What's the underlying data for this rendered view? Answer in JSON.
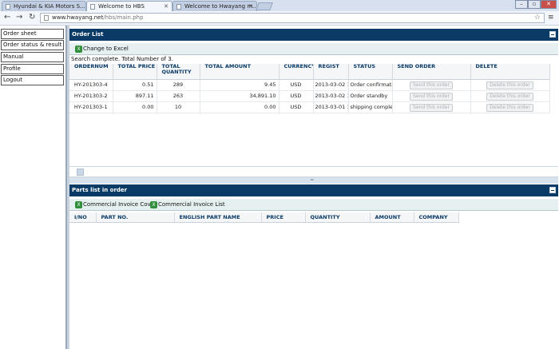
{
  "browser": {
    "tabs": [
      {
        "label": "Hyundai & KIA Motors S..."
      },
      {
        "label": "Welcome to HBS"
      },
      {
        "label": "Welcome to Hwayang m..."
      }
    ],
    "url_host": "www.hwayang.net",
    "url_path": "/hbs/main.php"
  },
  "sidebar": {
    "items": [
      {
        "label": "Order sheet"
      },
      {
        "label": "Order status & result"
      },
      {
        "label": "Manual"
      },
      {
        "label": "Profile"
      },
      {
        "label": "Logout"
      }
    ]
  },
  "order_list": {
    "title": "Order List",
    "excel_button": "Change to Excel",
    "status_text": "Search complete. Total Number of 3.",
    "columns": [
      "ORDERNUM",
      "TOTAL PRICE",
      "TOTAL QUANTITY",
      "TOTAL AMOUNT",
      "CURRENCY",
      "REGIST",
      "STATUS",
      "SEND ORDER",
      "DELETE"
    ],
    "send_label": "Send this order",
    "delete_label": "Delete this order",
    "rows": [
      {
        "ordernum": "HY-201303-4",
        "total_price": "0.51",
        "total_quantity": "289",
        "total_amount": "9.45",
        "currency": "USD",
        "regist": "2013-03-02 18",
        "status": "Order confirmatic"
      },
      {
        "ordernum": "HY-201303-2",
        "total_price": "897.11",
        "total_quantity": "263",
        "total_amount": "34,891.10",
        "currency": "USD",
        "regist": "2013-03-02 16",
        "status": "Order standby"
      },
      {
        "ordernum": "HY-201303-1",
        "total_price": "0.00",
        "total_quantity": "10",
        "total_amount": "0.00",
        "currency": "USD",
        "regist": "2013-03-01 15",
        "status": "shipping comple"
      }
    ]
  },
  "parts_list": {
    "title": "Parts list in order",
    "cover_button": "Commercial Invoice Cover",
    "list_button": "Commercial Invoice List",
    "columns": [
      "I/NO",
      "PART NO.",
      "ENGLISH PART NAME",
      "PRICE",
      "QUANTITY",
      "AMOUNT",
      "COMPANY"
    ]
  },
  "colors": {
    "header_navy": "#0a3a66",
    "button_bar": "#e6f0f1",
    "excel_green": "#2f8f3a"
  }
}
